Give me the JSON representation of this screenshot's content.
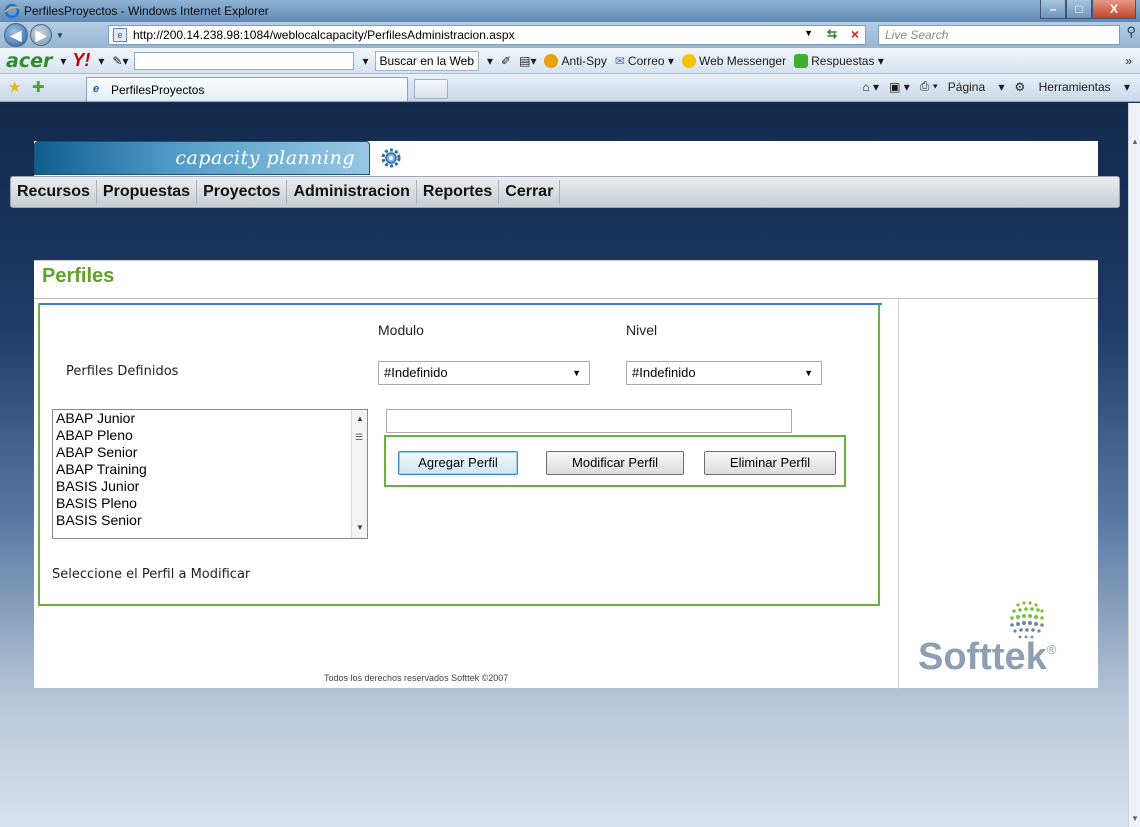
{
  "window": {
    "title": "PerfilesProyectos - Windows Internet Explorer",
    "min": "–",
    "max": "□",
    "close": "X"
  },
  "address": {
    "url": "http://200.14.238.98:1084/weblocalcapacity/PerfilesAdministracion.aspx",
    "search_placeholder": "Live Search"
  },
  "toolbar": {
    "acer": "acer",
    "yahoo": "Y!",
    "buscar": "Buscar en la Web",
    "antispy": "Anti-Spy",
    "correo": "Correo",
    "messenger": "Web Messenger",
    "respuestas": "Respuestas"
  },
  "tabs": {
    "active_tab": "PerfilesProyectos",
    "pagina": "Página",
    "herramientas": "Herramientas"
  },
  "app": {
    "brand": "capacity planning",
    "menu": [
      "Recursos",
      "Propuestas",
      "Proyectos",
      "Administracion",
      "Reportes",
      "Cerrar"
    ]
  },
  "content": {
    "title": "Perfiles",
    "modulo_label": "Modulo",
    "nivel_label": "Nivel",
    "perfiles_label": "Perfiles Definidos",
    "modulo_value": "#Indefinido",
    "nivel_value": "#Indefinido",
    "profiles": [
      "ABAP Junior",
      "ABAP Pleno",
      "ABAP Senior",
      "ABAP Training",
      "BASIS Junior",
      "BASIS Pleno",
      "BASIS Senior"
    ],
    "agregar": "Agregar Perfil",
    "modificar": "Modificar Perfil",
    "eliminar": "Eliminar Perfil",
    "hint": "Seleccione el Perfil a Modificar",
    "footer": "Todos los derechos reservados Softtek ©2007",
    "logo": "Softtek",
    "logo_reg": "®"
  }
}
